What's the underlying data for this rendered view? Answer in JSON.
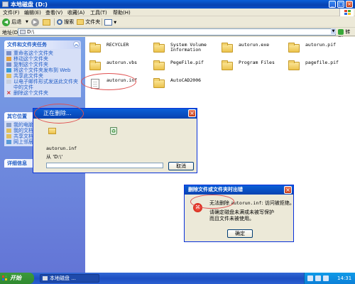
{
  "window": {
    "title": "本地磁盘 (D:)",
    "min": "_",
    "max": "□",
    "close": "×"
  },
  "menu": {
    "file": "文件(F)",
    "edit": "编辑(E)",
    "view": "查看(V)",
    "favorites": "收藏(A)",
    "tools": "工具(T)",
    "help": "帮助(H)"
  },
  "toolbar": {
    "back": "后退",
    "search": "搜索",
    "folders": "文件夹"
  },
  "address": {
    "label": "地址(D)",
    "value": "D:\\",
    "go": "转到"
  },
  "sidebar": {
    "tasks_title": "文件和文件夹任务",
    "tasks": [
      "重命名这个文件夹",
      "移动这个文件夹",
      "复制这个文件夹",
      "将这个文件夹发布到 Web",
      "共享此文件夹",
      "以电子邮件形式发送此文件夹中的文件",
      "删除这个文件夹"
    ],
    "places_title": "其它位置",
    "places": [
      "我的电脑",
      "我的文档",
      "共享文档",
      "网上邻居"
    ],
    "details_title": "详细信息"
  },
  "files": [
    {
      "name": "RECYCLER",
      "icon": "folder-icon"
    },
    {
      "name": "System Volume Information",
      "icon": "folder-icon"
    },
    {
      "name": "autorun.exe",
      "icon": "folder-icon"
    },
    {
      "name": "autorun.pif",
      "icon": "folder-icon"
    },
    {
      "name": "autorun.vbs",
      "icon": "folder-icon"
    },
    {
      "name": "PegeFile.pif",
      "icon": "folder-icon"
    },
    {
      "name": "Program Files",
      "icon": "folder-icon"
    },
    {
      "name": "pagefile.pif",
      "icon": "folder-icon"
    },
    {
      "name": "autorun.inf",
      "icon": "file-icon"
    },
    {
      "name": "AutoCAD2006",
      "icon": "folder-icon"
    }
  ],
  "deleting_dialog": {
    "title": "正在删除...",
    "filename": "autorun.inf",
    "from": "从 'D:\\'",
    "progress": 0,
    "cancel": "取消"
  },
  "error_dialog": {
    "title": "删除文件或文件夹时出错",
    "msg_cannot_delete": "无法删除",
    "msg_file": "autorun.inf",
    "msg_access_denied": ": 访问被拒绝。",
    "sub_line1": "请确定磁盘未满或未被写保护",
    "sub_line2": "而且文件未被使用。",
    "ok": "确定"
  },
  "taskbar": {
    "start": "开始",
    "task_label": "本地磁盘 ...",
    "clock": "14:31"
  },
  "colors": {
    "title_blue": "#0842b0",
    "task_link": "#215dc6",
    "annotation_red": "#e05050",
    "start_green": "#2f8a2f"
  }
}
